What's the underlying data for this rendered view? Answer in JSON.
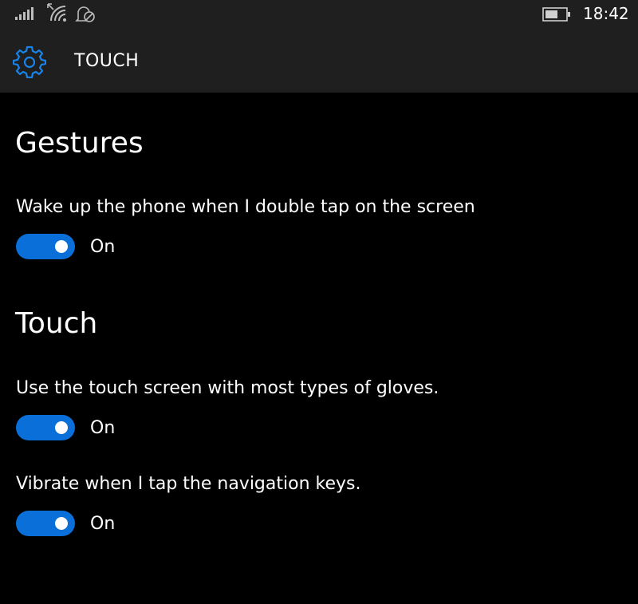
{
  "status_bar": {
    "time": "18:42",
    "icons": [
      "signal-bars-icon",
      "wifi-icon",
      "quiet-hours-icon",
      "battery-icon"
    ]
  },
  "header": {
    "title": "TOUCH",
    "icon": "gear-icon"
  },
  "sections": [
    {
      "heading": "Gestures",
      "settings": [
        {
          "label": "Wake up the phone when I double tap on the screen",
          "state": "On"
        }
      ]
    },
    {
      "heading": "Touch",
      "settings": [
        {
          "label": "Use the touch screen with most types of gloves.",
          "state": "On"
        },
        {
          "label": "Vibrate when I tap the navigation keys.",
          "state": "On"
        }
      ]
    }
  ],
  "colors": {
    "accent": "#0a6fd8",
    "chrome_background": "#1f1f1f",
    "page_background": "#000000",
    "text": "#ffffff"
  }
}
